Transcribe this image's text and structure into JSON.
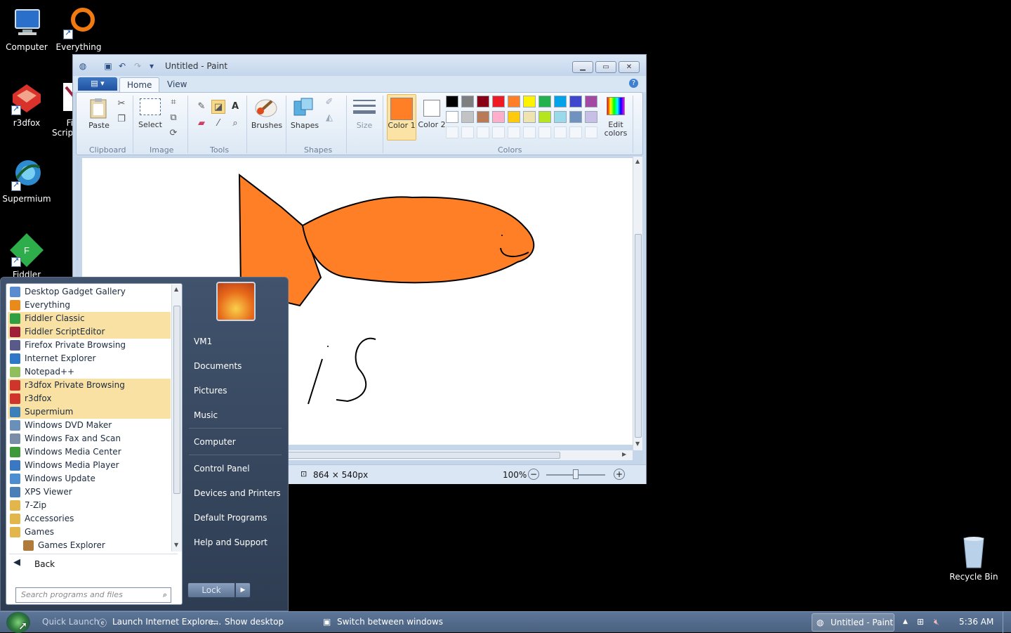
{
  "desktop": {
    "icons": [
      {
        "label": "Computer"
      },
      {
        "label": "Everything"
      },
      {
        "label": "r3dfox"
      },
      {
        "label": "Fi Scrip"
      },
      {
        "label": "Supermium"
      },
      {
        "label": "Fiddler"
      },
      {
        "label": "Recycle Bin"
      }
    ]
  },
  "paint": {
    "title": "Untitled - Paint",
    "tabs": [
      "Home",
      "View"
    ],
    "ribbon": {
      "paste": "Paste",
      "select": "Select",
      "brushes": "Brushes",
      "shapes": "Shapes",
      "size": "Size",
      "color1": "Color 1",
      "color2": "Color 2",
      "edit_colors": "Edit colors",
      "groups": [
        "Clipboard",
        "Image",
        "Tools",
        "Shapes",
        "Colors"
      ]
    },
    "palette": [
      "#000000",
      "#7f7f7f",
      "#880015",
      "#ed1c24",
      "#ff7f27",
      "#fff200",
      "#22b14c",
      "#00a2e8",
      "#3f48cc",
      "#a349a4",
      "#ffffff",
      "#c3c3c3",
      "#b97a57",
      "#ffaec9",
      "#ffc90e",
      "#efe4b0",
      "#b5e61d",
      "#99d9ea",
      "#7092be",
      "#c8bfe7"
    ],
    "color1_value": "#ff7f27",
    "color2_value": "#ffffff",
    "status": {
      "dimensions": "864 × 540px",
      "zoom": "100%"
    }
  },
  "startmenu": {
    "programs": [
      {
        "label": "Desktop Gadget Gallery",
        "hl": false,
        "color": "#5b8ccf"
      },
      {
        "label": "Everything",
        "hl": false,
        "color": "#e98b1a"
      },
      {
        "label": "Fiddler Classic",
        "hl": true,
        "color": "#2ea043"
      },
      {
        "label": "Fiddler ScriptEditor",
        "hl": true,
        "color": "#a0203a"
      },
      {
        "label": "Firefox Private Browsing",
        "hl": false,
        "color": "#5a5a8a"
      },
      {
        "label": "Internet Explorer",
        "hl": false,
        "color": "#2e78c7"
      },
      {
        "label": "Notepad++",
        "hl": false,
        "color": "#8fbf5a"
      },
      {
        "label": "r3dfox Private Browsing",
        "hl": true,
        "color": "#d0352b"
      },
      {
        "label": "r3dfox",
        "hl": true,
        "color": "#d0352b"
      },
      {
        "label": "Supermium",
        "hl": true,
        "color": "#3d7fb8"
      },
      {
        "label": "Windows DVD Maker",
        "hl": false,
        "color": "#6a8fb8"
      },
      {
        "label": "Windows Fax and Scan",
        "hl": false,
        "color": "#7a8ea8"
      },
      {
        "label": "Windows Media Center",
        "hl": false,
        "color": "#3c9a3a"
      },
      {
        "label": "Windows Media Player",
        "hl": false,
        "color": "#3a78c4"
      },
      {
        "label": "Windows Update",
        "hl": false,
        "color": "#4d8ed0"
      },
      {
        "label": "XPS Viewer",
        "hl": false,
        "color": "#4a7fb8"
      },
      {
        "label": "7-Zip",
        "hl": false,
        "color": "#e3b64c"
      },
      {
        "label": "Accessories",
        "hl": false,
        "color": "#e3b64c"
      },
      {
        "label": "Games",
        "hl": false,
        "color": "#e3b64c"
      },
      {
        "label": "Games Explorer",
        "hl": false,
        "color": "#b07a3a",
        "sub": true
      }
    ],
    "back": "Back",
    "search_placeholder": "Search programs and files",
    "right": [
      "VM1",
      "Documents",
      "Pictures",
      "Music",
      "Computer",
      "Control Panel",
      "Devices and Printers",
      "Default Programs",
      "Help and Support"
    ],
    "lock": "Lock"
  },
  "taskbar": {
    "quick_launch": "Quick Launch",
    "launch_ie": "Launch Internet Explore...",
    "show_desktop": "Show desktop",
    "switch_windows": "Switch between windows",
    "paint_item": "Untitled - Paint",
    "clock": "5:36 AM"
  }
}
